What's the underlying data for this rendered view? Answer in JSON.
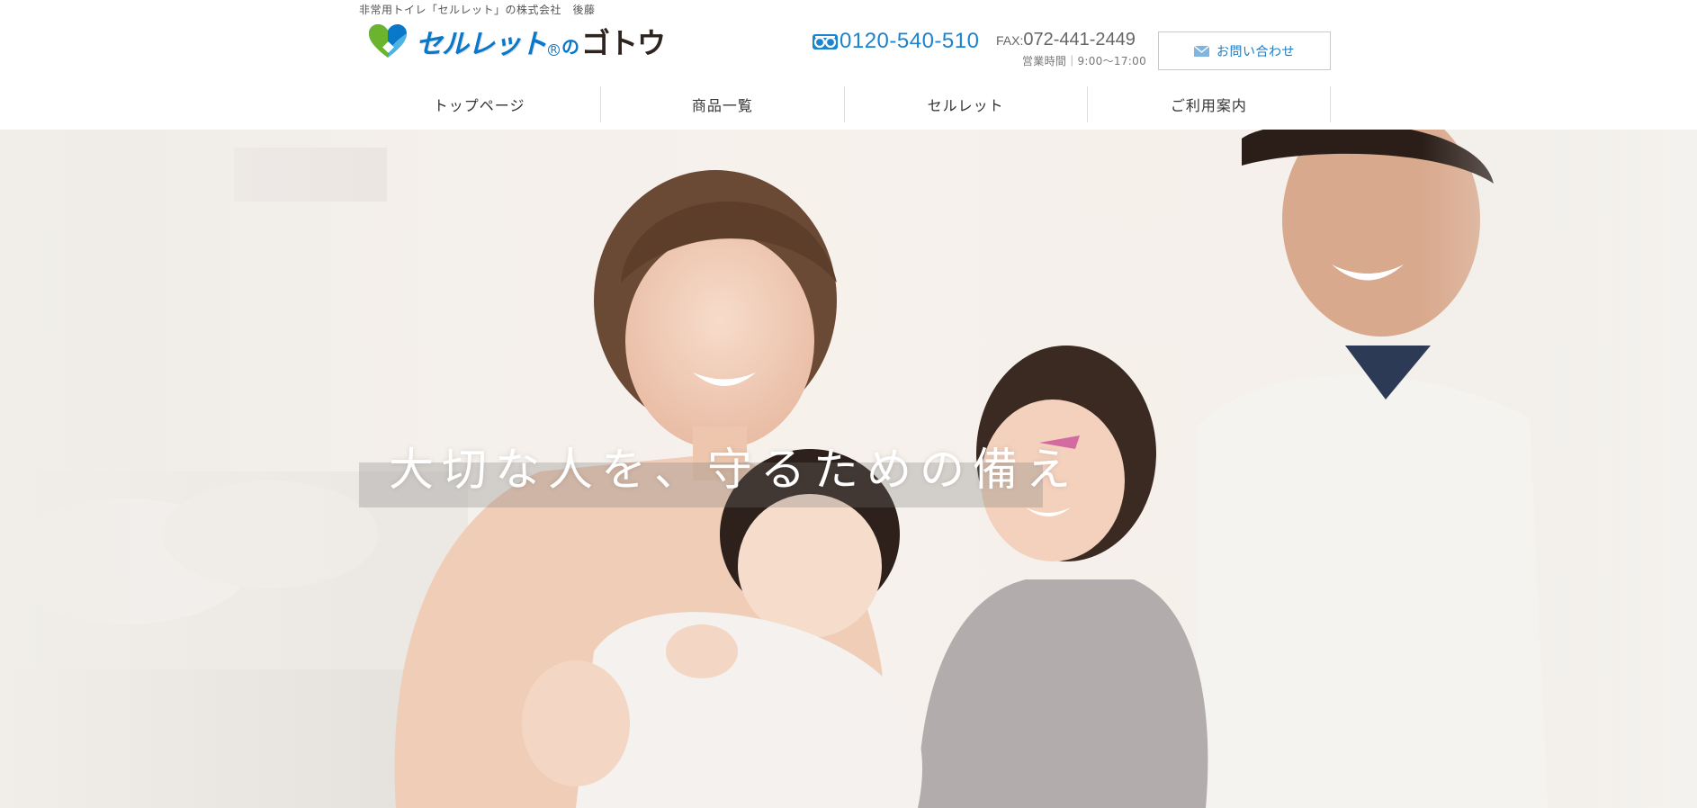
{
  "header": {
    "tagline": "非常用トイレ「セルレット」の株式会社　後藤",
    "logo": {
      "main": "セルレット",
      "registered": "R",
      "connector": "の",
      "company": "ゴトウ",
      "icon": "heart-logo-icon"
    },
    "phone": {
      "icon": "free-dial-icon",
      "number": "0120-540-510"
    },
    "fax": {
      "label": "FAX:",
      "number": "072-441-2449"
    },
    "hours": "営業時間｜9:00〜17:00",
    "contact": {
      "icon": "mail-icon",
      "label": "お問い合わせ"
    }
  },
  "nav": {
    "items": [
      {
        "label": "トップページ"
      },
      {
        "label": "商品一覧"
      },
      {
        "label": "セルレット"
      },
      {
        "label": "ご利用案内"
      }
    ]
  },
  "hero": {
    "caption": "大切な人を、守るための備え"
  },
  "colors": {
    "brand_blue": "#0a78c8",
    "phone_blue": "#1a84d1",
    "logo_green": "#6ab42e",
    "dark_brown": "#2d2420"
  }
}
